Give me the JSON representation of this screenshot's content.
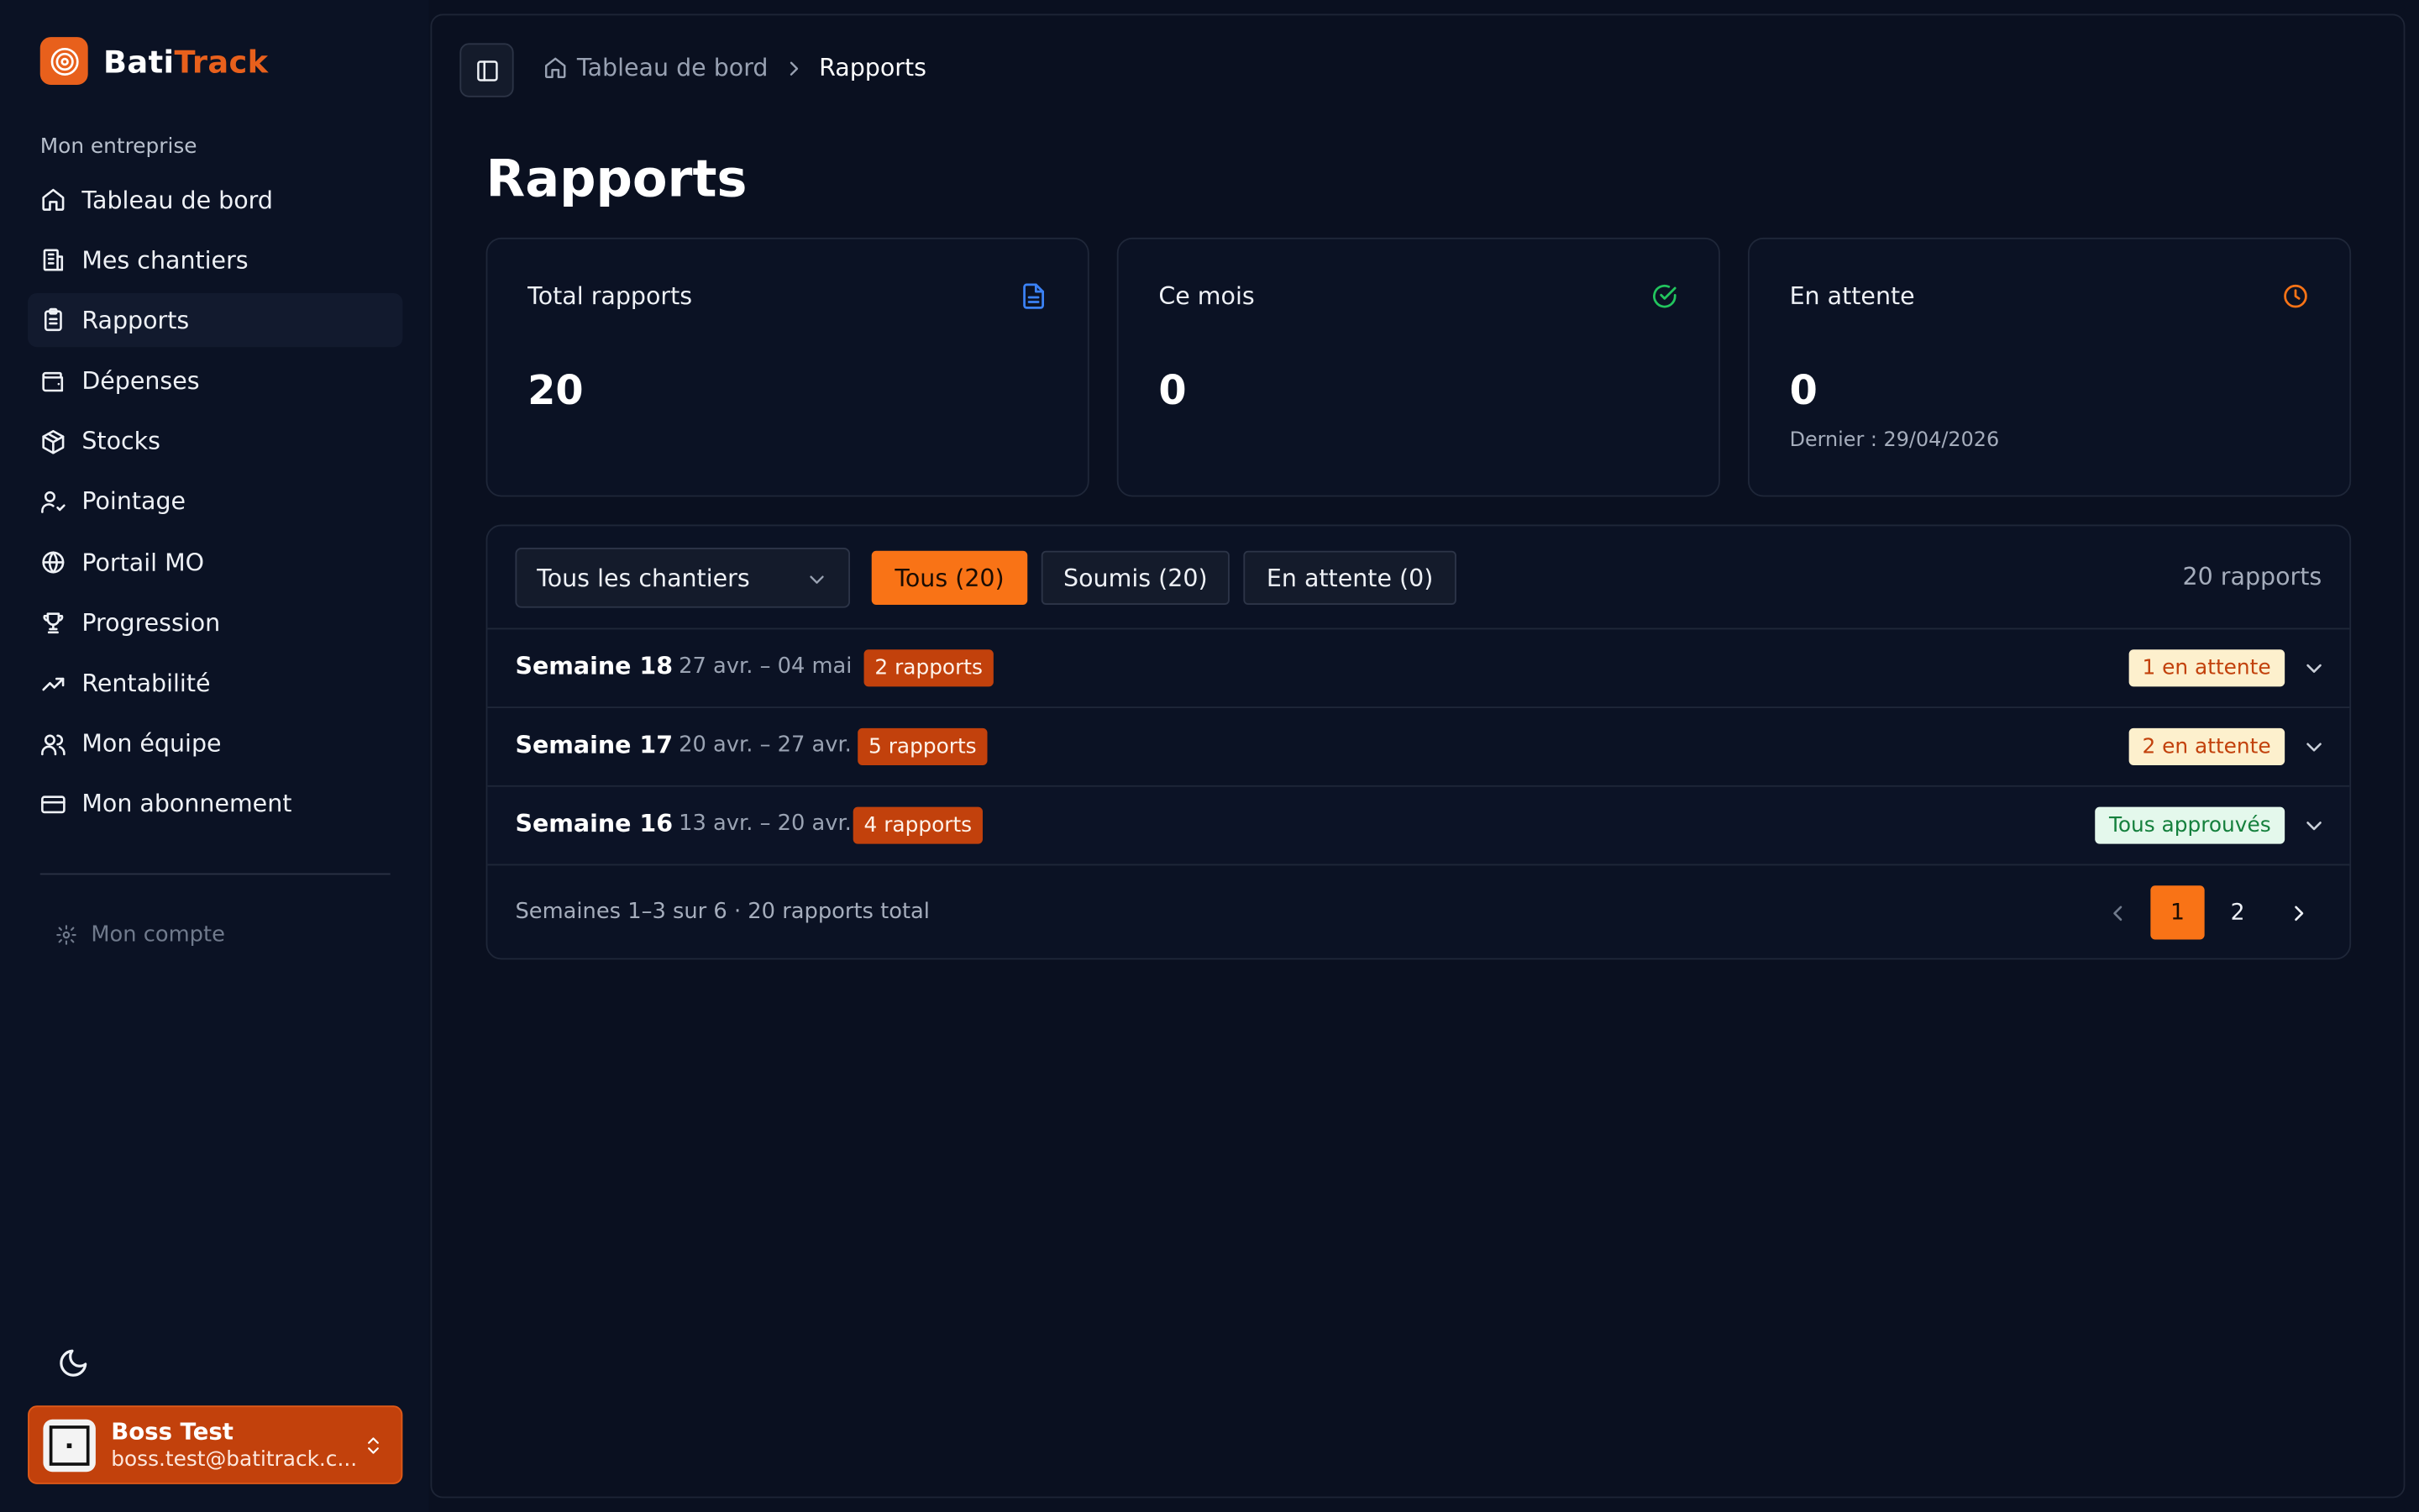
{
  "brand": {
    "name_part1": "Bati",
    "name_part2": "Track",
    "accent": "#e8601c"
  },
  "sidebar": {
    "section_label": "Mon entreprise",
    "items": [
      {
        "label": "Tableau de bord",
        "icon": "home-icon"
      },
      {
        "label": "Mes chantiers",
        "icon": "building-icon"
      },
      {
        "label": "Rapports",
        "icon": "clipboard-icon",
        "active": true
      },
      {
        "label": "Dépenses",
        "icon": "wallet-icon"
      },
      {
        "label": "Stocks",
        "icon": "package-icon"
      },
      {
        "label": "Pointage",
        "icon": "user-check-icon"
      },
      {
        "label": "Portail MO",
        "icon": "globe-icon"
      },
      {
        "label": "Progression",
        "icon": "trophy-icon"
      },
      {
        "label": "Rentabilité",
        "icon": "trending-up-icon"
      },
      {
        "label": "Mon équipe",
        "icon": "users-icon"
      },
      {
        "label": "Mon abonnement",
        "icon": "credit-card-icon"
      }
    ],
    "account_label": "Mon compte",
    "user": {
      "name": "Boss Test",
      "email": "boss.test@batitrack.c..."
    }
  },
  "breadcrumb": {
    "home": "Tableau de bord",
    "current": "Rapports"
  },
  "page_title": "Rapports",
  "stats": [
    {
      "label": "Total rapports",
      "value": "20",
      "icon": "file-text-icon",
      "color": "#3b82f6"
    },
    {
      "label": "Ce mois",
      "value": "0",
      "icon": "check-circle-icon",
      "color": "#22c55e"
    },
    {
      "label": "En attente",
      "value": "0",
      "sub": "Dernier : 29/04/2026",
      "icon": "clock-icon",
      "color": "#f97316"
    }
  ],
  "filters": {
    "site_select": "Tous les chantiers",
    "chips": [
      "Tous (20)",
      "Soumis (20)",
      "En attente (0)"
    ],
    "count": "20 rapports"
  },
  "weeks": [
    {
      "title": "Semaine 18",
      "dates": "27 avr. – 04 mai",
      "badge": "2 rapports",
      "status": "1 en attente",
      "status_type": "pending"
    },
    {
      "title": "Semaine 17",
      "dates": "20 avr. – 27 avr.",
      "badge": "5 rapports",
      "status": "2 en attente",
      "status_type": "pending"
    },
    {
      "title": "Semaine 16",
      "dates": "13 avr. – 20 avr.",
      "badge": "4 rapports",
      "status": "Tous approuvés",
      "status_type": "ok"
    }
  ],
  "pagination": {
    "info": "Semaines 1–3 sur 6 · 20 rapports total",
    "pages": [
      "1",
      "2"
    ],
    "current": "1"
  }
}
